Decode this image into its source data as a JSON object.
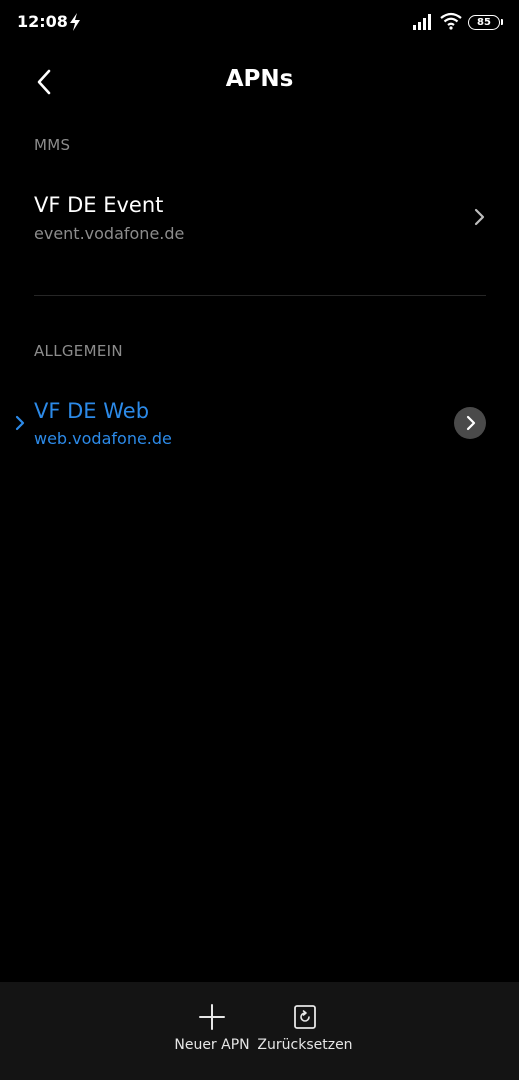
{
  "status_bar": {
    "time": "12:08",
    "battery": "85"
  },
  "header": {
    "title": "APNs"
  },
  "sections": {
    "mms": {
      "title": "MMS",
      "items": [
        {
          "name": "VF DE Event",
          "url": "event.vodafone.de"
        }
      ]
    },
    "general": {
      "title": "ALLGEMEIN",
      "items": [
        {
          "name": "VF DE Web",
          "url": "web.vodafone.de",
          "selected": true
        }
      ]
    }
  },
  "bottom_bar": {
    "new_apn": "Neuer APN",
    "reset": "Zurücksetzen"
  },
  "colors": {
    "accent": "#2c8ae8",
    "background": "#000000",
    "secondary_text": "#8c8c8c"
  }
}
